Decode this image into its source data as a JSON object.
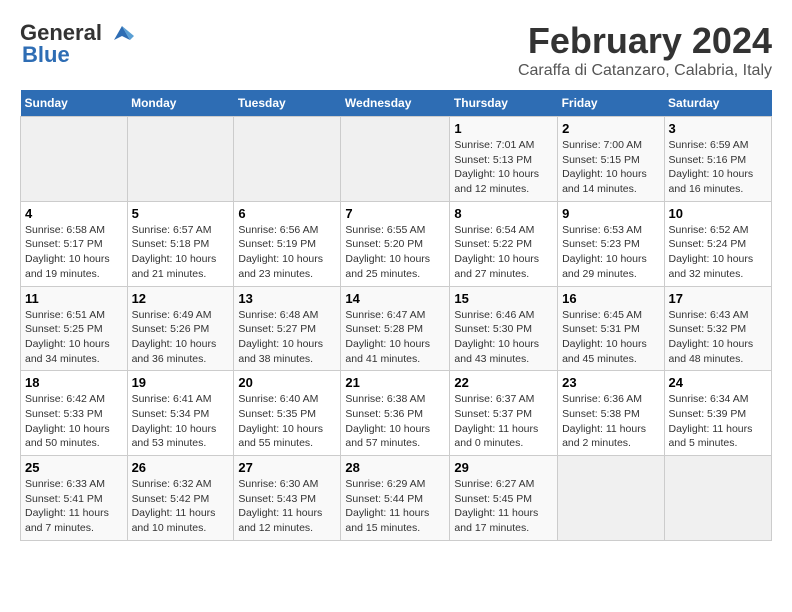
{
  "logo": {
    "general": "General",
    "blue": "Blue"
  },
  "title": "February 2024",
  "subtitle": "Caraffa di Catanzaro, Calabria, Italy",
  "days_of_week": [
    "Sunday",
    "Monday",
    "Tuesday",
    "Wednesday",
    "Thursday",
    "Friday",
    "Saturday"
  ],
  "weeks": [
    [
      {
        "day": "",
        "info": ""
      },
      {
        "day": "",
        "info": ""
      },
      {
        "day": "",
        "info": ""
      },
      {
        "day": "",
        "info": ""
      },
      {
        "day": "1",
        "info": "Sunrise: 7:01 AM\nSunset: 5:13 PM\nDaylight: 10 hours and 12 minutes."
      },
      {
        "day": "2",
        "info": "Sunrise: 7:00 AM\nSunset: 5:15 PM\nDaylight: 10 hours and 14 minutes."
      },
      {
        "day": "3",
        "info": "Sunrise: 6:59 AM\nSunset: 5:16 PM\nDaylight: 10 hours and 16 minutes."
      }
    ],
    [
      {
        "day": "4",
        "info": "Sunrise: 6:58 AM\nSunset: 5:17 PM\nDaylight: 10 hours and 19 minutes."
      },
      {
        "day": "5",
        "info": "Sunrise: 6:57 AM\nSunset: 5:18 PM\nDaylight: 10 hours and 21 minutes."
      },
      {
        "day": "6",
        "info": "Sunrise: 6:56 AM\nSunset: 5:19 PM\nDaylight: 10 hours and 23 minutes."
      },
      {
        "day": "7",
        "info": "Sunrise: 6:55 AM\nSunset: 5:20 PM\nDaylight: 10 hours and 25 minutes."
      },
      {
        "day": "8",
        "info": "Sunrise: 6:54 AM\nSunset: 5:22 PM\nDaylight: 10 hours and 27 minutes."
      },
      {
        "day": "9",
        "info": "Sunrise: 6:53 AM\nSunset: 5:23 PM\nDaylight: 10 hours and 29 minutes."
      },
      {
        "day": "10",
        "info": "Sunrise: 6:52 AM\nSunset: 5:24 PM\nDaylight: 10 hours and 32 minutes."
      }
    ],
    [
      {
        "day": "11",
        "info": "Sunrise: 6:51 AM\nSunset: 5:25 PM\nDaylight: 10 hours and 34 minutes."
      },
      {
        "day": "12",
        "info": "Sunrise: 6:49 AM\nSunset: 5:26 PM\nDaylight: 10 hours and 36 minutes."
      },
      {
        "day": "13",
        "info": "Sunrise: 6:48 AM\nSunset: 5:27 PM\nDaylight: 10 hours and 38 minutes."
      },
      {
        "day": "14",
        "info": "Sunrise: 6:47 AM\nSunset: 5:28 PM\nDaylight: 10 hours and 41 minutes."
      },
      {
        "day": "15",
        "info": "Sunrise: 6:46 AM\nSunset: 5:30 PM\nDaylight: 10 hours and 43 minutes."
      },
      {
        "day": "16",
        "info": "Sunrise: 6:45 AM\nSunset: 5:31 PM\nDaylight: 10 hours and 45 minutes."
      },
      {
        "day": "17",
        "info": "Sunrise: 6:43 AM\nSunset: 5:32 PM\nDaylight: 10 hours and 48 minutes."
      }
    ],
    [
      {
        "day": "18",
        "info": "Sunrise: 6:42 AM\nSunset: 5:33 PM\nDaylight: 10 hours and 50 minutes."
      },
      {
        "day": "19",
        "info": "Sunrise: 6:41 AM\nSunset: 5:34 PM\nDaylight: 10 hours and 53 minutes."
      },
      {
        "day": "20",
        "info": "Sunrise: 6:40 AM\nSunset: 5:35 PM\nDaylight: 10 hours and 55 minutes."
      },
      {
        "day": "21",
        "info": "Sunrise: 6:38 AM\nSunset: 5:36 PM\nDaylight: 10 hours and 57 minutes."
      },
      {
        "day": "22",
        "info": "Sunrise: 6:37 AM\nSunset: 5:37 PM\nDaylight: 11 hours and 0 minutes."
      },
      {
        "day": "23",
        "info": "Sunrise: 6:36 AM\nSunset: 5:38 PM\nDaylight: 11 hours and 2 minutes."
      },
      {
        "day": "24",
        "info": "Sunrise: 6:34 AM\nSunset: 5:39 PM\nDaylight: 11 hours and 5 minutes."
      }
    ],
    [
      {
        "day": "25",
        "info": "Sunrise: 6:33 AM\nSunset: 5:41 PM\nDaylight: 11 hours and 7 minutes."
      },
      {
        "day": "26",
        "info": "Sunrise: 6:32 AM\nSunset: 5:42 PM\nDaylight: 11 hours and 10 minutes."
      },
      {
        "day": "27",
        "info": "Sunrise: 6:30 AM\nSunset: 5:43 PM\nDaylight: 11 hours and 12 minutes."
      },
      {
        "day": "28",
        "info": "Sunrise: 6:29 AM\nSunset: 5:44 PM\nDaylight: 11 hours and 15 minutes."
      },
      {
        "day": "29",
        "info": "Sunrise: 6:27 AM\nSunset: 5:45 PM\nDaylight: 11 hours and 17 minutes."
      },
      {
        "day": "",
        "info": ""
      },
      {
        "day": "",
        "info": ""
      }
    ]
  ]
}
